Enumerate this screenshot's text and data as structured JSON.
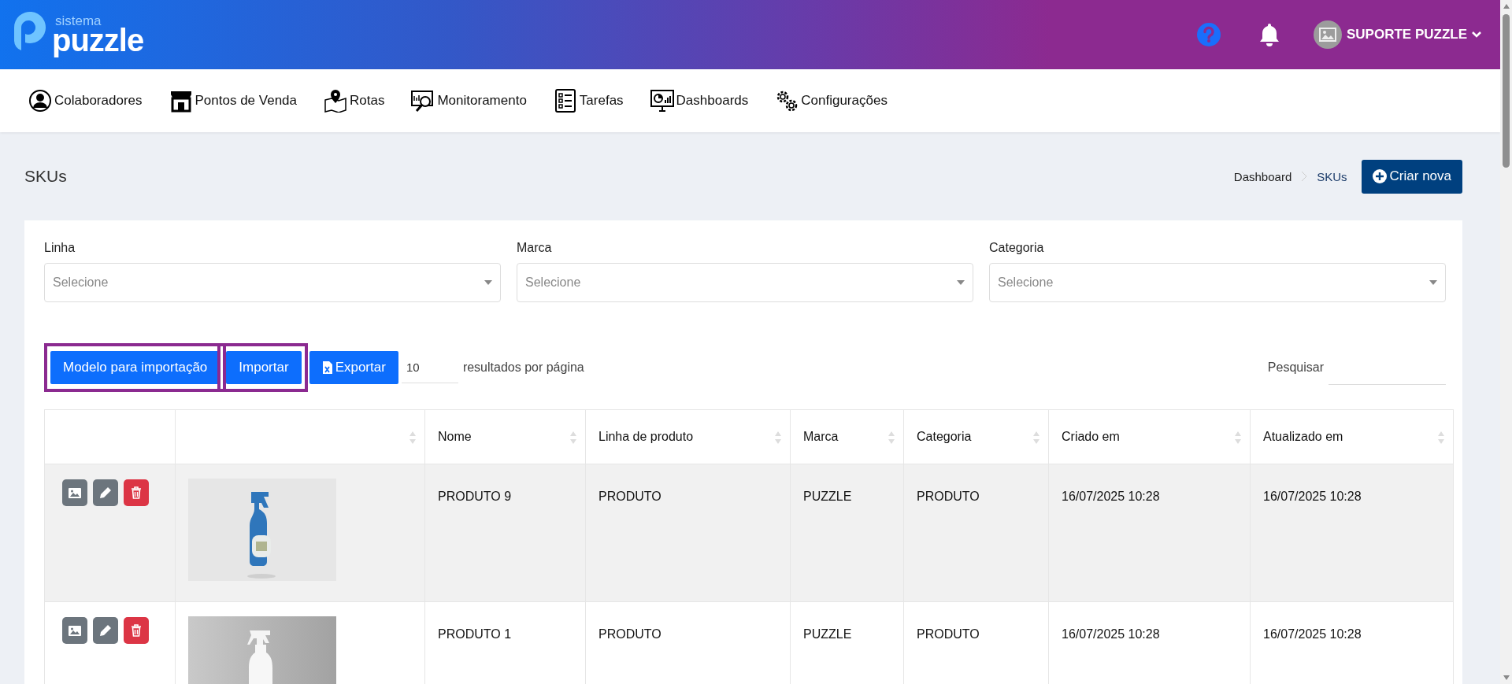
{
  "header": {
    "logo_small": "sistema",
    "logo_big": "puzzle",
    "user": "SUPORTE PUZZLE"
  },
  "nav": [
    {
      "label": "Colaboradores"
    },
    {
      "label": "Pontos de Venda"
    },
    {
      "label": "Rotas"
    },
    {
      "label": "Monitoramento"
    },
    {
      "label": "Tarefas"
    },
    {
      "label": "Dashboards"
    },
    {
      "label": "Configurações"
    }
  ],
  "page": {
    "title": "SKUs",
    "breadcrumb": [
      {
        "label": "Dashboard",
        "current": false
      },
      {
        "label": "SKUs",
        "current": true
      }
    ],
    "create_button": "Criar nova"
  },
  "filters": [
    {
      "label": "Linha",
      "placeholder": "Selecione"
    },
    {
      "label": "Marca",
      "placeholder": "Selecione"
    },
    {
      "label": "Categoria",
      "placeholder": "Selecione"
    }
  ],
  "toolbar": {
    "buttons": [
      {
        "label": "Modelo para importação",
        "highlighted": true,
        "kind": "plain"
      },
      {
        "label": "Importar",
        "highlighted": true,
        "kind": "plain"
      },
      {
        "label": "Exportar",
        "highlighted": false,
        "kind": "excel"
      }
    ],
    "page_size": "10",
    "page_size_label": "resultados por página",
    "search_label": "Pesquisar"
  },
  "table": {
    "columns": [
      {
        "sortable": false
      },
      {
        "sortable": true
      },
      {
        "label": "Nome",
        "sortable": true
      },
      {
        "label": "Linha de produto",
        "sortable": true
      },
      {
        "label": "Marca",
        "sortable": true
      },
      {
        "label": "Categoria",
        "sortable": true
      },
      {
        "label": "Criado em",
        "sortable": true
      },
      {
        "label": "Atualizado em",
        "sortable": true
      }
    ],
    "rows": [
      {
        "highlighted": true,
        "cells": [
          "",
          "",
          "PRODUTO 9",
          "PRODUTO",
          "PUZZLE",
          "PRODUTO",
          "16/07/2025 10:28",
          "16/07/2025 10:28"
        ]
      },
      {
        "highlighted": false,
        "cells": [
          "",
          "",
          "PRODUTO 1",
          "PRODUTO",
          "PUZZLE",
          "PRODUTO",
          "16/07/2025 10:28",
          "16/07/2025 10:28"
        ]
      }
    ]
  }
}
